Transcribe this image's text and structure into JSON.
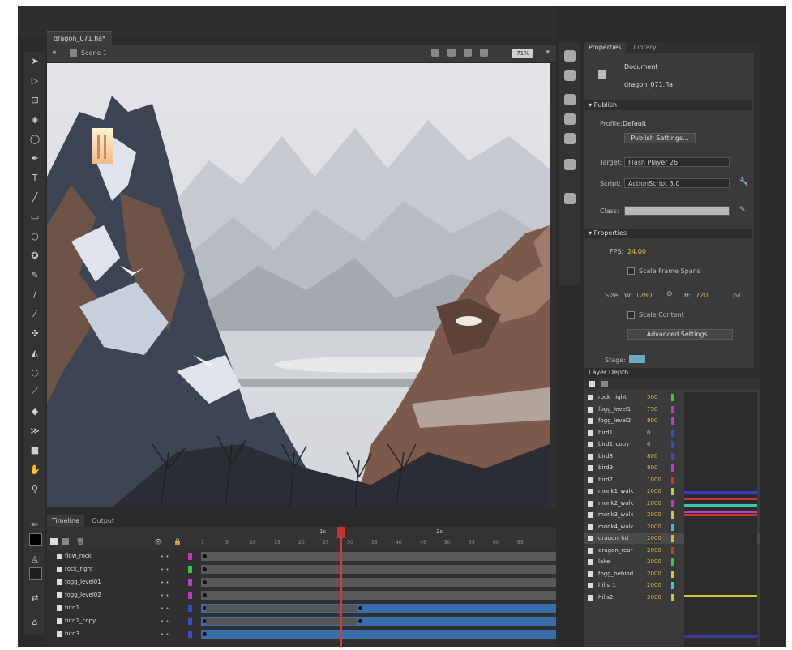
{
  "document_tab": "dragon_071.fla*",
  "scene_label": "Scene 1",
  "zoom_value": "71%",
  "properties_panel": {
    "tabs": [
      "Properties",
      "Library"
    ],
    "document_label": "Document",
    "file_name": "dragon_071.fla",
    "publish_section": "Publish",
    "profile_label": "Profile:",
    "profile_value": "Default",
    "publish_settings_button": "Publish Settings...",
    "target_label": "Target:",
    "target_value": "Flash Player 26",
    "script_label": "Script:",
    "script_value": "ActionScript 3.0",
    "class_label": "Class:",
    "properties_section": "Properties",
    "fps_label": "FPS:",
    "fps_value": "24.00",
    "scale_frame_spans": "Scale Frame Spans",
    "size_label": "Size:",
    "width_label": "W:",
    "width_value": "1280",
    "height_label": "H:",
    "height_value": "720",
    "unit": "px",
    "scale_content": "Scale Content",
    "advanced_settings_button": "Advanced Settings...",
    "stage_label": "Stage:",
    "stage_color": "#6fa8c4"
  },
  "layer_depth": {
    "title": "Layer Depth",
    "rows": [
      {
        "name": "rock_right",
        "depth": "500",
        "color": "#39c83a"
      },
      {
        "name": "fogg_level1",
        "depth": "750",
        "color": "#c03ac8"
      },
      {
        "name": "fogg_level2",
        "depth": "800",
        "color": "#c03ac8"
      },
      {
        "name": "bird1",
        "depth": "0",
        "color": "#3a4ac8"
      },
      {
        "name": "bird1_copy",
        "depth": "0",
        "color": "#3a4ac8"
      },
      {
        "name": "bird8",
        "depth": "800",
        "color": "#3a4ac8"
      },
      {
        "name": "bird9",
        "depth": "800",
        "color": "#c03ac8"
      },
      {
        "name": "bird7",
        "depth": "1000",
        "color": "#c83a3a"
      },
      {
        "name": "monk1_walk",
        "depth": "2000",
        "color": "#c8c83a"
      },
      {
        "name": "monk2_walk",
        "depth": "2000",
        "color": "#c03ac8"
      },
      {
        "name": "monk3_walk",
        "depth": "2000",
        "color": "#c8c83a"
      },
      {
        "name": "monk4_walk",
        "depth": "2000",
        "color": "#3ac8c8"
      },
      {
        "name": "dragon_hd",
        "depth": "2000",
        "color": "#c8c83a"
      },
      {
        "name": "dragon_rear",
        "depth": "2000",
        "color": "#c83a3a"
      },
      {
        "name": "lake",
        "depth": "2000",
        "color": "#3ac83a"
      },
      {
        "name": "fogg_behind...",
        "depth": "2000",
        "color": "#c8c83a"
      },
      {
        "name": "hills_1",
        "depth": "2000",
        "color": "#3ac8c8"
      },
      {
        "name": "hills2",
        "depth": "2000",
        "color": "#c8c83a"
      }
    ],
    "graph_lines": [
      "#3a3ac8",
      "#c83a3a",
      "#3ac8a8",
      "#c83ac8",
      "#c83a3a",
      "#c8c83a",
      "#3a3a9a"
    ]
  },
  "timeline": {
    "tabs": [
      "Timeline",
      "Output"
    ],
    "second_marks": [
      "1s",
      "2s"
    ],
    "frame_ticks": [
      "1",
      "5",
      "10",
      "15",
      "20",
      "25",
      "30",
      "35",
      "40",
      "45",
      "50",
      "55",
      "60",
      "65"
    ],
    "layers": [
      {
        "name": "flow_rock",
        "color": "#c03ac8",
        "selected": false
      },
      {
        "name": "rock_right",
        "color": "#39c83a",
        "selected": false
      },
      {
        "name": "fogg_level01",
        "color": "#c03ac8",
        "selected": false
      },
      {
        "name": "fogg_level02",
        "color": "#c03ac8",
        "selected": false
      },
      {
        "name": "bird1",
        "color": "#3a4ac8",
        "selected": true
      },
      {
        "name": "bird1_copy",
        "color": "#3a4ac8",
        "selected": true
      },
      {
        "name": "bird3",
        "color": "#3a4ac8",
        "selected": true
      }
    ]
  },
  "colors": {
    "accent": "#c23434",
    "selection": "#3b6ea8"
  }
}
